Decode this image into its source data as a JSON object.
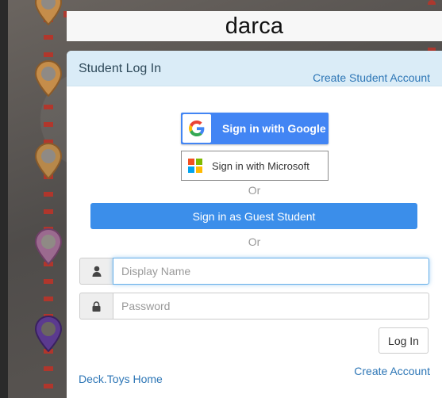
{
  "app": {
    "title": "darca"
  },
  "panel": {
    "title": "Student Log In",
    "create_student_link": "Create Student Account"
  },
  "auth": {
    "google_label": "Sign in with Google",
    "microsoft_label": "Sign in with Microsoft",
    "or_1": "Or",
    "guest_label": "Sign in as Guest Student",
    "or_2": "Or"
  },
  "form": {
    "display_name_placeholder": "Display Name",
    "password_placeholder": "Password",
    "login_label": "Log In"
  },
  "footer": {
    "create_account_link": "Create Account",
    "home_link": "Deck.Toys Home"
  },
  "colors": {
    "accent": "#4285f4",
    "guest": "#3b8eea",
    "link": "#2d76b6",
    "header_bg": "#daecf7"
  },
  "icons": {
    "user_icon": "user-icon",
    "lock_icon": "lock-icon",
    "google_icon": "google-icon",
    "microsoft_icon": "microsoft-icon"
  }
}
